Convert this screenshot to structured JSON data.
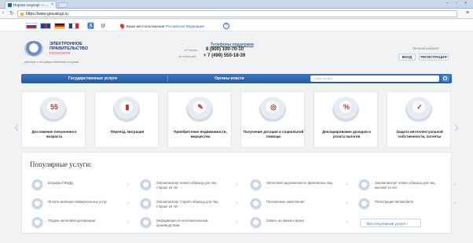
{
  "browser": {
    "tab_title": "Портал госуслуг — ...",
    "url": "https://www.gosuslugi.ru",
    "window_controls": "– ▫ ×"
  },
  "topstrip": {
    "location_label": "Ваше местоположение:",
    "location_value": "Российская Федерация",
    "help": "?"
  },
  "header": {
    "logo_line1": "ЭЛЕКТРОННОЕ",
    "logo_line2": "ПРАВИТЕЛЬСТВО",
    "logo_line3": "ГОСУСЛУГИ",
    "slogan": "Доступ к государственным услугам",
    "phones_title": "Телефоны поддержки",
    "phone1_label": "в России",
    "phone1": "8 (800) 100-70-10",
    "phone2_label": "за границей",
    "phone2": "+ 7 (499) 550-18-39",
    "cabinet_label": "Личный кабинет",
    "login": "ВХОД",
    "register": "РЕГИСТРАЦИЯ"
  },
  "mainnav": {
    "services": "Государственные услуги",
    "authorities": "Органы власти",
    "search_placeholder": "Поиск услуги"
  },
  "categories": [
    {
      "glyph": "55",
      "label": "Достижение пенсионного возраста"
    },
    {
      "glyph": "▮",
      "label": "Переезд, миграция"
    },
    {
      "glyph": "✎",
      "label": "Приобретение недвижимости, имущества"
    },
    {
      "glyph": "◎",
      "label": "Получение дотации и социальной помощи"
    },
    {
      "glyph": "%",
      "label": "Декларирование доходов и уплата налогов"
    },
    {
      "glyph": "✓",
      "label": "Защита интеллектуальной собственности, патенты"
    }
  ],
  "popular": {
    "title": "Популярные услуги:",
    "all_link": "Все популярные услуги",
    "items": [
      {
        "label": "Штрафы ГИБДД"
      },
      {
        "label": "Загранпаспорт нового образца для лиц старше 18 лет"
      },
      {
        "label": "Налоговая задолженность физических лиц"
      },
      {
        "label": "Загранпаспорт нового образца для лиц моложе 14 лет"
      },
      {
        "label": "Оплата жилищно-коммунальных услуг"
      },
      {
        "label": "Загранпаспорт старого образца для лиц старше 18 лет"
      },
      {
        "label": "Пенсионные накопления"
      },
      {
        "label": "Регистрация автомобиля"
      },
      {
        "label": "Подача налоговой декларации"
      },
      {
        "label": "Информация по исполнительным производствам"
      },
      {
        "label": "Запись на прием к врачу"
      }
    ]
  }
}
